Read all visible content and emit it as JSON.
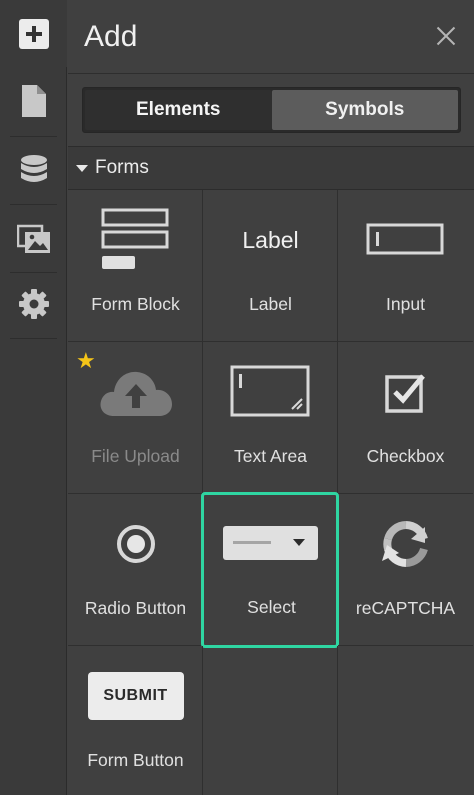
{
  "rail": {
    "items": [
      {
        "name": "add",
        "icon": "plus-icon"
      },
      {
        "name": "pages",
        "icon": "page-icon"
      },
      {
        "name": "cms",
        "icon": "database-icon"
      },
      {
        "name": "assets",
        "icon": "images-icon"
      },
      {
        "name": "settings",
        "icon": "gear-icon"
      }
    ]
  },
  "panel": {
    "title": "Add",
    "tabs": [
      {
        "label": "Elements",
        "active": true
      },
      {
        "label": "Symbols",
        "active": false
      }
    ],
    "section": {
      "label": "Forms",
      "expanded": true
    },
    "elements": [
      {
        "label": "Form Block",
        "icon": "form-block-icon"
      },
      {
        "label": "Label",
        "icon": "label-icon",
        "icon_text": "Label"
      },
      {
        "label": "Input",
        "icon": "input-icon"
      },
      {
        "label": "File Upload",
        "icon": "cloud-upload-icon",
        "disabled": true,
        "starred": true
      },
      {
        "label": "Text Area",
        "icon": "text-area-icon"
      },
      {
        "label": "Checkbox",
        "icon": "checkbox-icon"
      },
      {
        "label": "Radio Button",
        "icon": "radio-icon"
      },
      {
        "label": "Select",
        "icon": "select-icon",
        "selected": true
      },
      {
        "label": "reCAPTCHA",
        "icon": "recaptcha-icon"
      },
      {
        "label": "Form Button",
        "icon": "submit-button-icon",
        "icon_text": "SUBMIT"
      }
    ]
  },
  "colors": {
    "accent": "#2fd6a2",
    "star": "#f5c518",
    "background": "#404040"
  }
}
